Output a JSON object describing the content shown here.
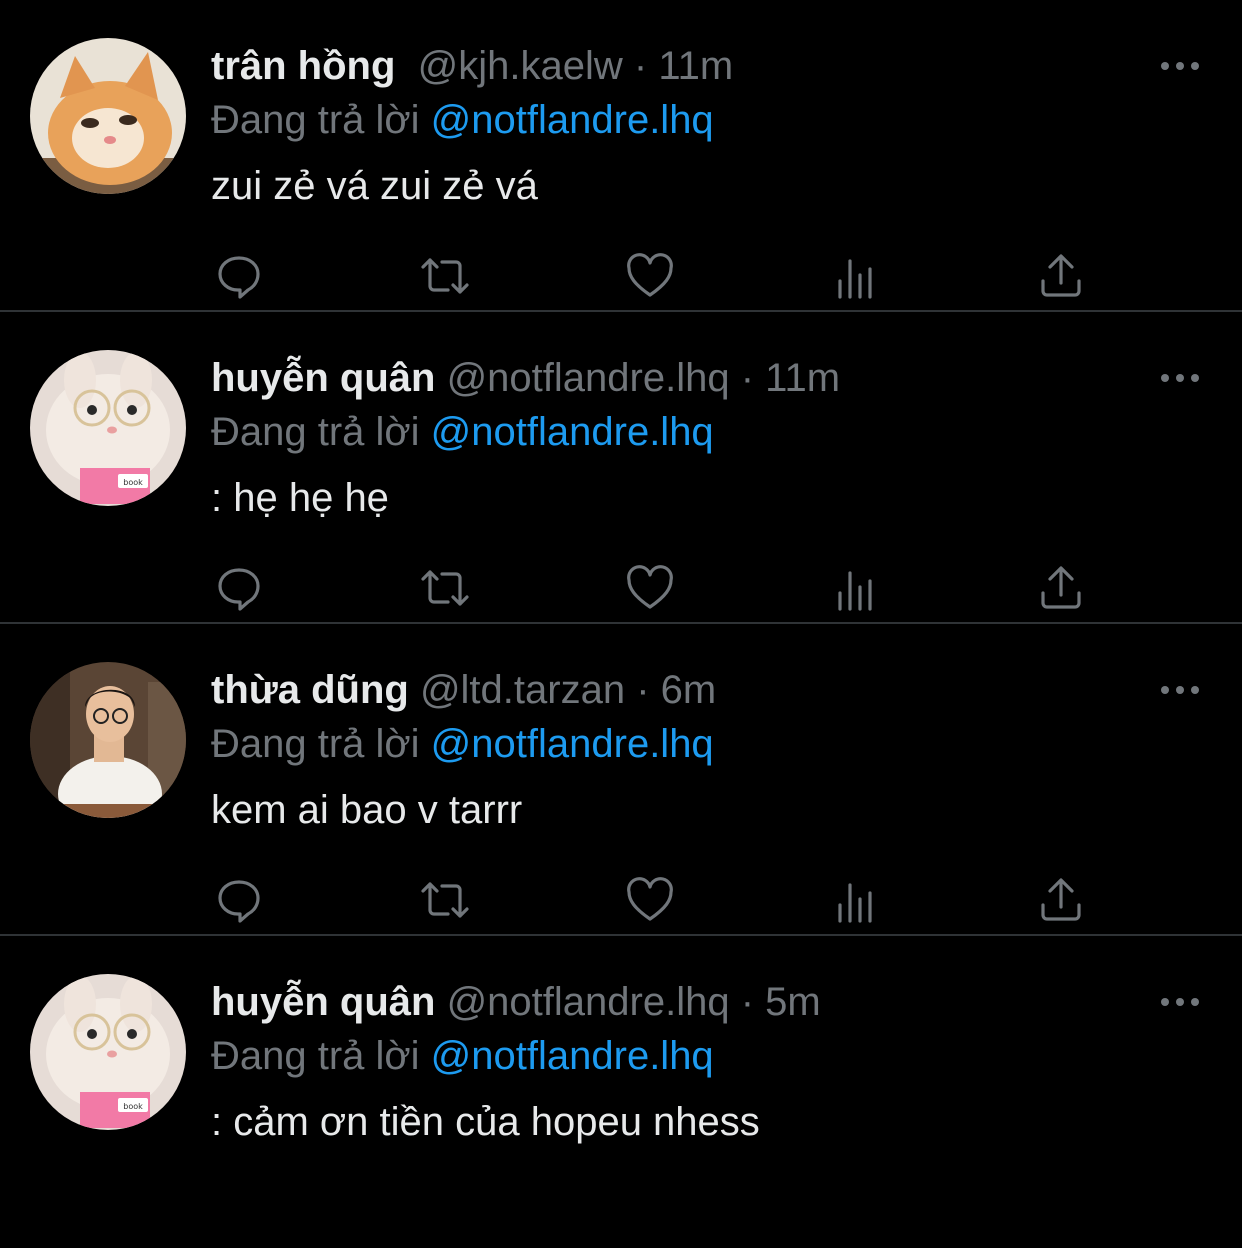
{
  "tweets": [
    {
      "name": "trân hồng",
      "handle": "@kjh.kaelw",
      "dot": "·",
      "time": "11m",
      "replying_label": "Đang trả lời",
      "replying_to": "@notflandre.lhq",
      "text": "zui zẻ vá zui zẻ vá",
      "avatar": "cat-avatar"
    },
    {
      "name": "huyễn quân",
      "handle": "@notflandre.lhq",
      "dot": "·",
      "time": "11m",
      "replying_label": "Đang trả lời",
      "replying_to": "@notflandre.lhq",
      "text": ": hẹ hẹ hẹ",
      "avatar": "bunny-avatar",
      "avatar_book_label": "book"
    },
    {
      "name": "thừa dũng",
      "handle": "@ltd.tarzan",
      "dot": "·",
      "time": "6m",
      "replying_label": "Đang trả lời",
      "replying_to": "@notflandre.lhq",
      "text": "kem ai bao v tarrr",
      "avatar": "person-avatar"
    },
    {
      "name": "huyễn quân",
      "handle": "@notflandre.lhq",
      "dot": "·",
      "time": "5m",
      "replying_label": "Đang trả lời",
      "replying_to": "@notflandre.lhq",
      "text": ": cảm ơn tiền của hopeu nhess",
      "avatar": "bunny-avatar",
      "avatar_book_label": "book"
    }
  ],
  "actions": [
    "reply-icon",
    "retweet-icon",
    "like-icon",
    "views-icon",
    "share-icon"
  ],
  "colors": {
    "background": "#000000",
    "text": "#e7e9ea",
    "muted": "#71767b",
    "accent": "#1d9bf0",
    "divider": "#2f3336"
  }
}
